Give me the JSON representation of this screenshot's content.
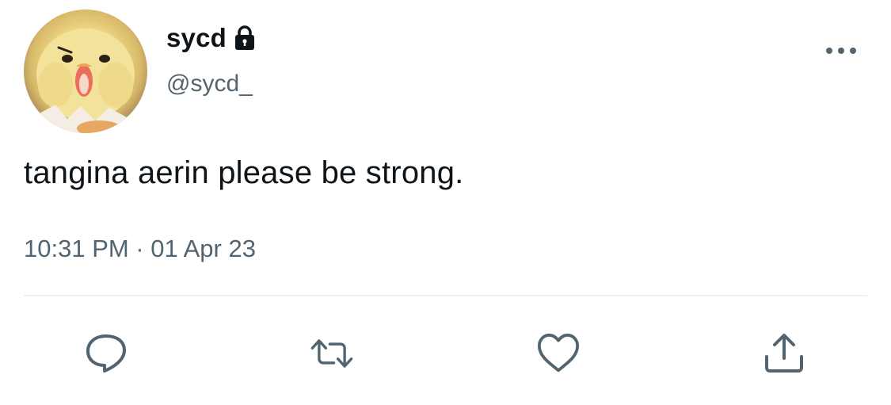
{
  "author": {
    "display_name": "sycd",
    "handle": "@sycd_",
    "protected_icon": "lock-icon",
    "avatar_icon": "chick-avatar"
  },
  "tweet": {
    "text": "tangina aerin please be strong.",
    "timestamp": "10:31 PM · 01 Apr 23"
  },
  "menu": {
    "icon": "more-horizontal-icon"
  },
  "actions": [
    {
      "name": "reply",
      "icon": "reply-icon"
    },
    {
      "name": "retweet",
      "icon": "retweet-icon"
    },
    {
      "name": "like",
      "icon": "heart-icon"
    },
    {
      "name": "share",
      "icon": "share-icon"
    }
  ],
  "colors": {
    "text_primary": "#0f1419",
    "text_secondary": "#536471",
    "icon": "#536471",
    "divider": "#eff3f4"
  }
}
